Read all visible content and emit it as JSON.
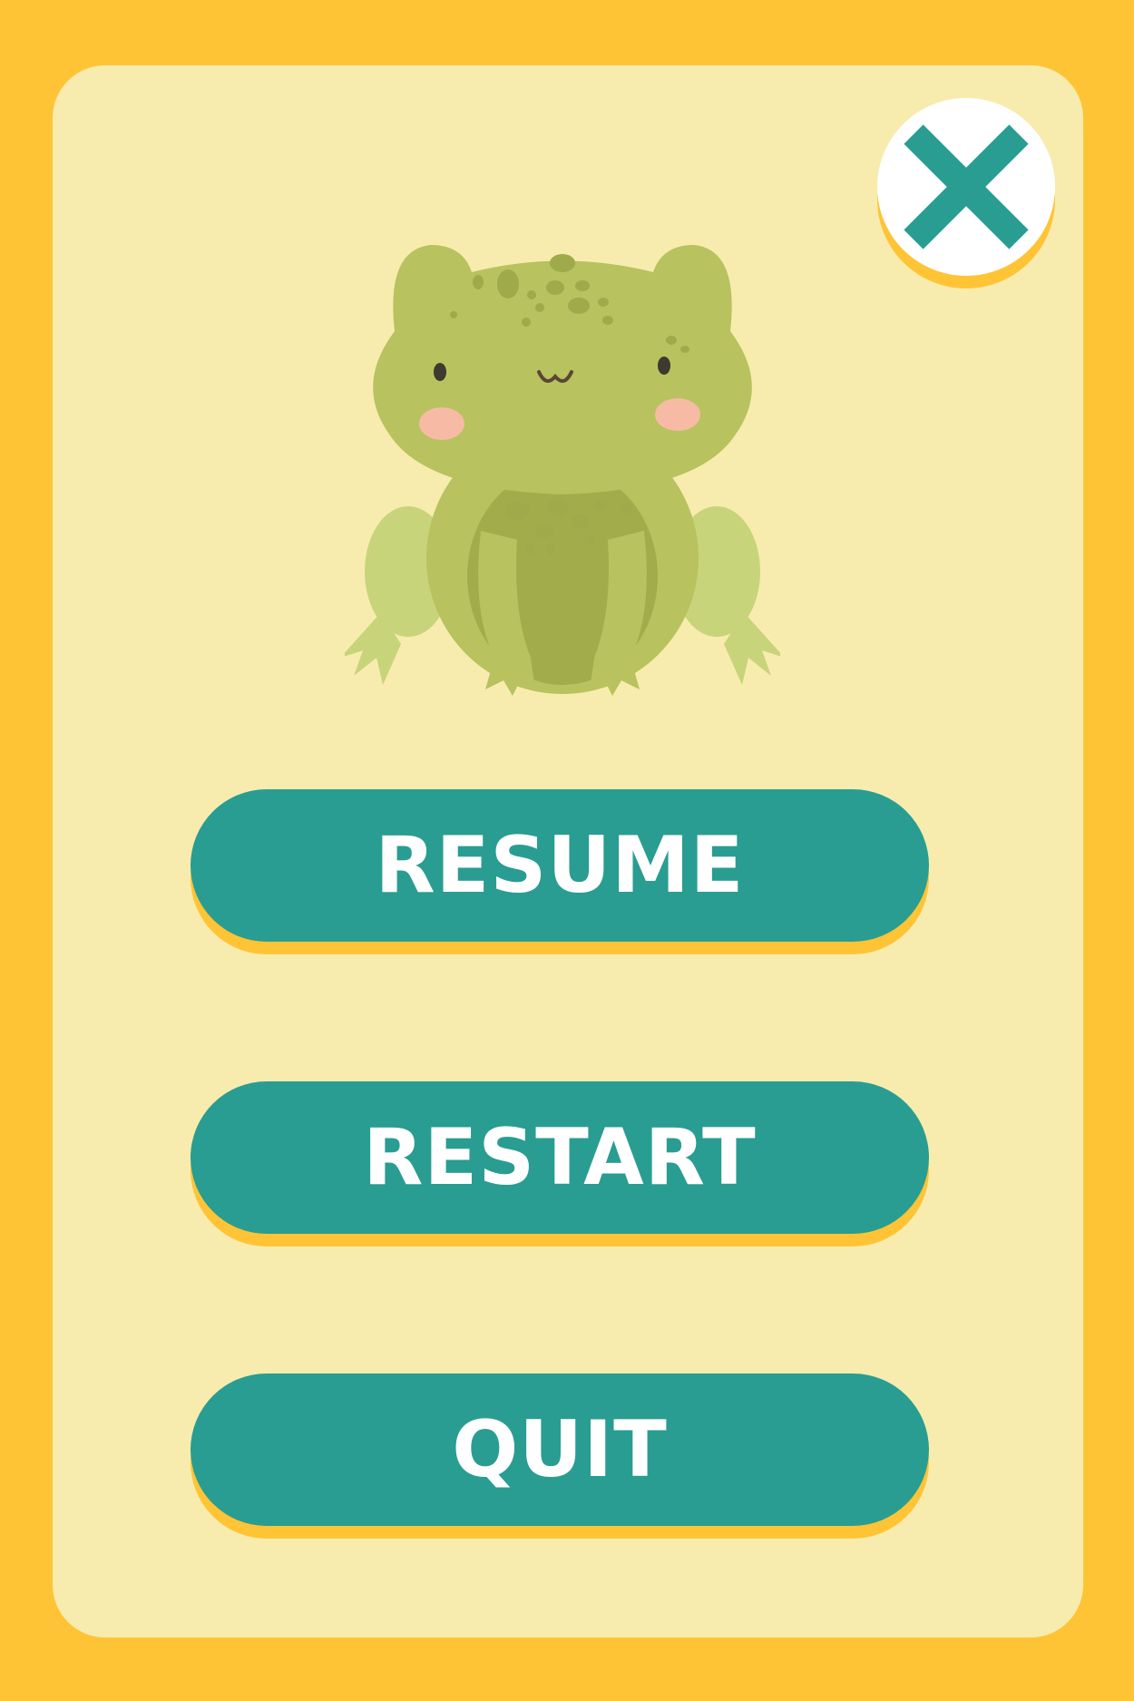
{
  "colors": {
    "background": "#FFC436",
    "panel": "#F7ECAE",
    "button": "#299D91",
    "button_text": "#FFFFFF",
    "close_icon": "#299D91"
  },
  "close_button": {
    "icon": "close-icon"
  },
  "character": {
    "icon": "frog-icon"
  },
  "menu": {
    "resume_label": "RESUME",
    "restart_label": "RESTART",
    "quit_label": "QUIT"
  }
}
